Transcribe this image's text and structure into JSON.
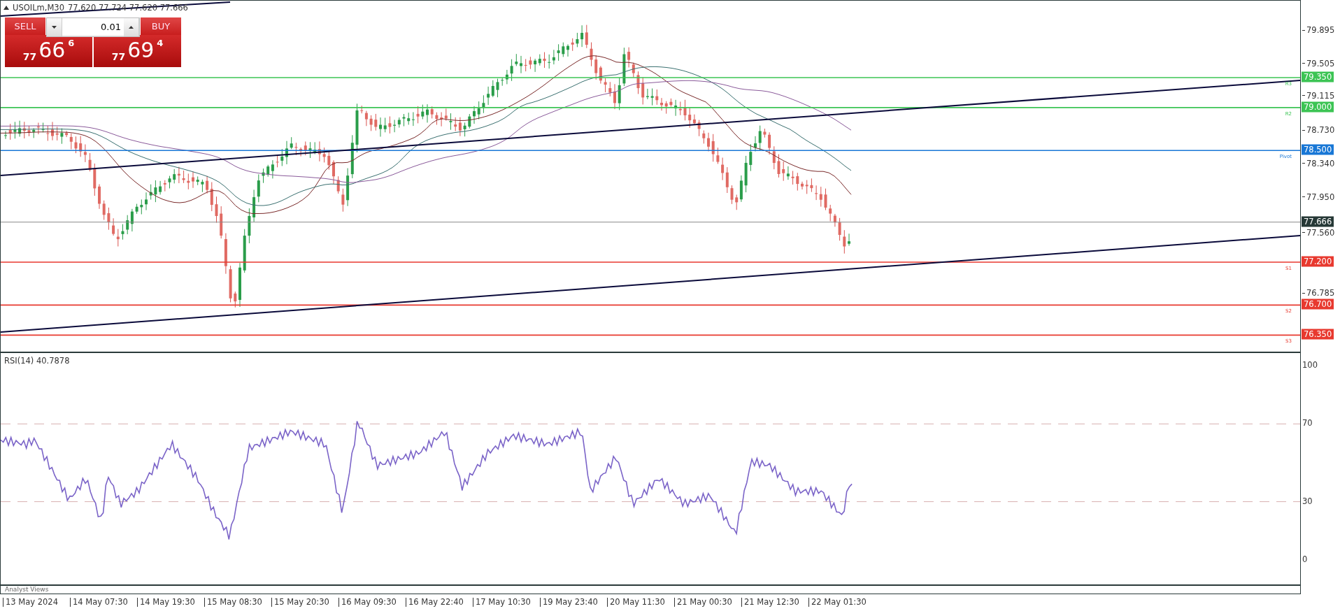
{
  "symbol_bar": {
    "title": "USOILm,M30",
    "ohlc": "77.620 77.724 77.620 77.666"
  },
  "trade_panel": {
    "sell_label": "SELL",
    "buy_label": "BUY",
    "lot": "0.01",
    "sell_price": {
      "prefix": "77",
      "main": "66",
      "suffix": "6"
    },
    "buy_price": {
      "prefix": "77",
      "main": "69",
      "suffix": "4"
    }
  },
  "price_axis": {
    "ticks": [
      "79.895",
      "79.505",
      "79.115",
      "78.730",
      "78.340",
      "77.950",
      "77.560",
      "76.785"
    ]
  },
  "levels": [
    {
      "name": "R3",
      "value": "79.350",
      "color": "#3cc454"
    },
    {
      "name": "R2",
      "value": "79.000",
      "color": "#3cc454"
    },
    {
      "name": "Pivot",
      "value": "78.500",
      "color": "#1877d6"
    },
    {
      "name": "S1",
      "value": "77.200",
      "color": "#e8392f"
    },
    {
      "name": "S2",
      "value": "76.700",
      "color": "#e8392f"
    },
    {
      "name": "S3",
      "value": "76.350",
      "color": "#e8392f"
    }
  ],
  "current_price": "77.666",
  "rsi": {
    "label": "RSI(14) 40.7878",
    "ticks": [
      "100",
      "70",
      "30",
      "0"
    ]
  },
  "bottom_strip": {
    "label": "Analyst Views"
  },
  "time_axis": [
    "13 May 2024",
    "14 May 07:30",
    "14 May 19:30",
    "15 May 08:30",
    "15 May 20:30",
    "16 May 09:30",
    "16 May 22:40",
    "17 May 10:30",
    "19 May 23:40",
    "20 May 11:30",
    "21 May 00:30",
    "21 May 12:30",
    "22 May 01:30"
  ]
}
